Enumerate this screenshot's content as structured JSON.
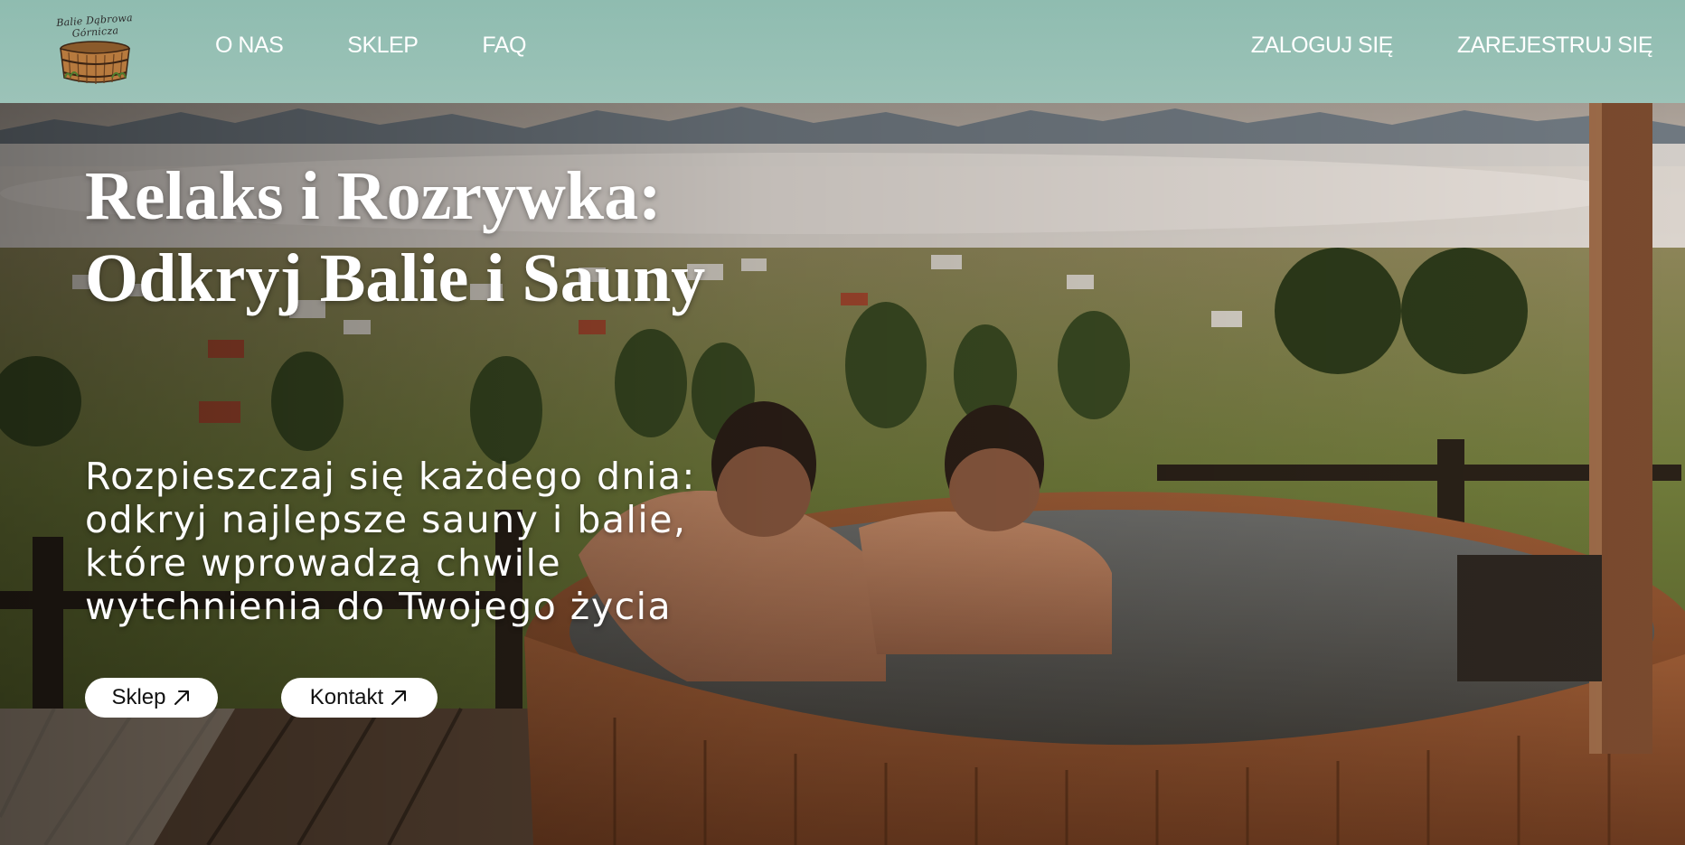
{
  "header": {
    "logo_text": "Balie Dąbrowa Górnicza",
    "nav_left": [
      "O NAS",
      "SKLEP",
      "FAQ"
    ],
    "nav_right": [
      "ZALOGUJ SIĘ",
      "ZAREJESTRUJ SIĘ"
    ]
  },
  "hero": {
    "title": "Relaks i Rozrywka: Odkryj Balie i Sauny",
    "subtitle": "Rozpieszczaj się każdego dnia: odkryj najlepsze sauny i balie, które wprowadzą chwile wytchnienia do Twojego życia",
    "buttons": {
      "shop_label": "Sklep",
      "contact_label": "Kontakt"
    },
    "arrow_icon": "arrow-up-right-icon"
  },
  "colors": {
    "header_bg": "#9cc3b8",
    "text_light": "#ffffff",
    "button_bg": "#ffffff",
    "button_text": "#111111"
  }
}
